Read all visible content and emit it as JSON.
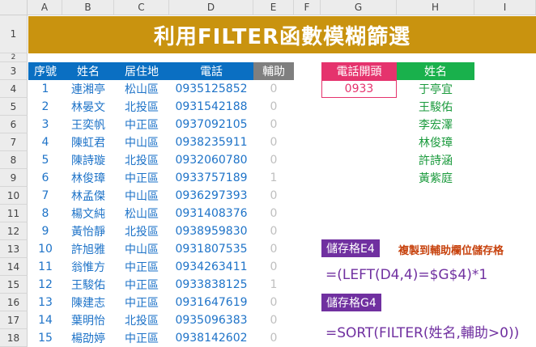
{
  "columns": [
    "A",
    "B",
    "C",
    "D",
    "E",
    "F",
    "G",
    "H",
    "I"
  ],
  "rows": [
    "1",
    "2",
    "3",
    "4",
    "5",
    "6",
    "7",
    "8",
    "9",
    "10",
    "11",
    "12",
    "13",
    "14",
    "15",
    "16",
    "17",
    "18"
  ],
  "title": "利用FILTER函數模糊篩選",
  "table": {
    "headers": [
      "序號",
      "姓名",
      "居住地",
      "電話",
      "輔助"
    ],
    "records": [
      [
        "1",
        "連湘亭",
        "松山區",
        "0935125852",
        "0"
      ],
      [
        "2",
        "林晏文",
        "北投區",
        "0931542188",
        "0"
      ],
      [
        "3",
        "王奕帆",
        "中正區",
        "0937092105",
        "0"
      ],
      [
        "4",
        "陳虹君",
        "中山區",
        "0938235911",
        "0"
      ],
      [
        "5",
        "陳詩璇",
        "北投區",
        "0932060780",
        "0"
      ],
      [
        "6",
        "林俊璋",
        "中正區",
        "0933757189",
        "1"
      ],
      [
        "7",
        "林孟傑",
        "中山區",
        "0936297393",
        "0"
      ],
      [
        "8",
        "楊文純",
        "松山區",
        "0931408376",
        "0"
      ],
      [
        "9",
        "黃怡靜",
        "北投區",
        "0938959830",
        "0"
      ],
      [
        "10",
        "許旭雅",
        "中山區",
        "0931807535",
        "0"
      ],
      [
        "11",
        "翁惟方",
        "中正區",
        "0934263411",
        "0"
      ],
      [
        "12",
        "王駿佑",
        "中正區",
        "0933838125",
        "1"
      ],
      [
        "13",
        "陳建志",
        "中正區",
        "0931647619",
        "0"
      ],
      [
        "14",
        "葉明怡",
        "北投區",
        "0935096383",
        "0"
      ],
      [
        "15",
        "楊劭婷",
        "中正區",
        "0938142602",
        "0"
      ]
    ]
  },
  "lookup": {
    "phone_prefix_label": "電話開頭",
    "phone_prefix_value": "0933",
    "name_label": "姓名",
    "results": [
      "于亭宜",
      "王駿佑",
      "李宏澤",
      "林俊璋",
      "許詩涵",
      "黃紫庭"
    ]
  },
  "notes": {
    "e4_tag": "儲存格E4",
    "e4_note": "複製到輔助欄位儲存格",
    "e4_formula": "=(LEFT(D4,4)=$G$4)*1",
    "g4_tag": "儲存格G4",
    "g4_formula": "=SORT(FILTER(姓名,輔助>0))"
  },
  "colors": {
    "title_bg": "#c9930f",
    "header_blue": "#0a6fc2",
    "header_gray": "#7f7f7f",
    "header_pink": "#e5336d",
    "header_green": "#19b14c",
    "tag_purple": "#7030a0",
    "note_orange": "#c7420d"
  }
}
